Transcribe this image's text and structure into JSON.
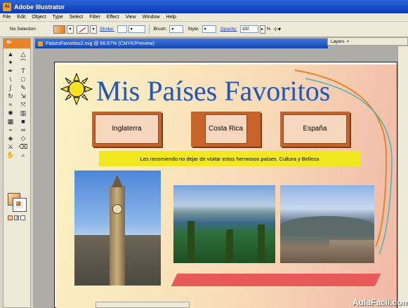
{
  "window": {
    "title": "Adobe Illustrator",
    "app_icon": "Ai"
  },
  "menubar": {
    "items": [
      "File",
      "Edit",
      "Object",
      "Type",
      "Select",
      "Filter",
      "Effect",
      "View",
      "Window",
      "Help"
    ]
  },
  "control_bar": {
    "selection": "No Selection",
    "stroke_label": "Stroke:",
    "brush_label": "Brush:",
    "style_label": "Style:",
    "opacity_label": "Opacity:",
    "opacity_value": "100",
    "opacity_unit": "%"
  },
  "document": {
    "tab_title": "PaisesFavoritos2.svg @ 66.67% (CMYK/Preview)"
  },
  "panels": {
    "layers_tab": "Layers"
  },
  "toolbox": {
    "header": "Ai",
    "tools": [
      "selection-tool",
      "direct-selection-tool",
      "magic-wand-tool",
      "lasso-tool",
      "pen-tool",
      "type-tool",
      "line-tool",
      "rectangle-tool",
      "paintbrush-tool",
      "pencil-tool",
      "rotate-tool",
      "scale-tool",
      "warp-tool",
      "free-transform-tool",
      "symbol-sprayer-tool",
      "graph-tool",
      "mesh-tool",
      "gradient-tool",
      "eyedropper-tool",
      "blend-tool",
      "live-paint-tool",
      "live-paint-selection-tool",
      "slice-tool",
      "eraser-tool",
      "hand-tool",
      "zoom-tool"
    ],
    "tool_glyphs": [
      "▲",
      "△",
      "✦",
      "⌒",
      "✒",
      "T",
      "\\",
      "□",
      "∫",
      "✎",
      "↻",
      "⇲",
      "≈",
      "⤧",
      "✺",
      "▥",
      "▦",
      "■",
      "⌁",
      "∞",
      "◈",
      "◇",
      "⚔",
      "⌫",
      "✋",
      "⌕"
    ]
  },
  "artwork": {
    "title": "Mis Países Favoritos",
    "buttons": [
      "Inglaterra",
      "Costa Rica",
      "España"
    ],
    "banner": "Les recomiendo no dejar de visitar estos hermosos países. Cultura y Belleza",
    "colors": {
      "title": "#2957a8",
      "button_frame": "#c8622a",
      "banner": "#f1e81f",
      "accent_bar": "#e85a5a"
    }
  },
  "watermark": "AulaFacil.com"
}
